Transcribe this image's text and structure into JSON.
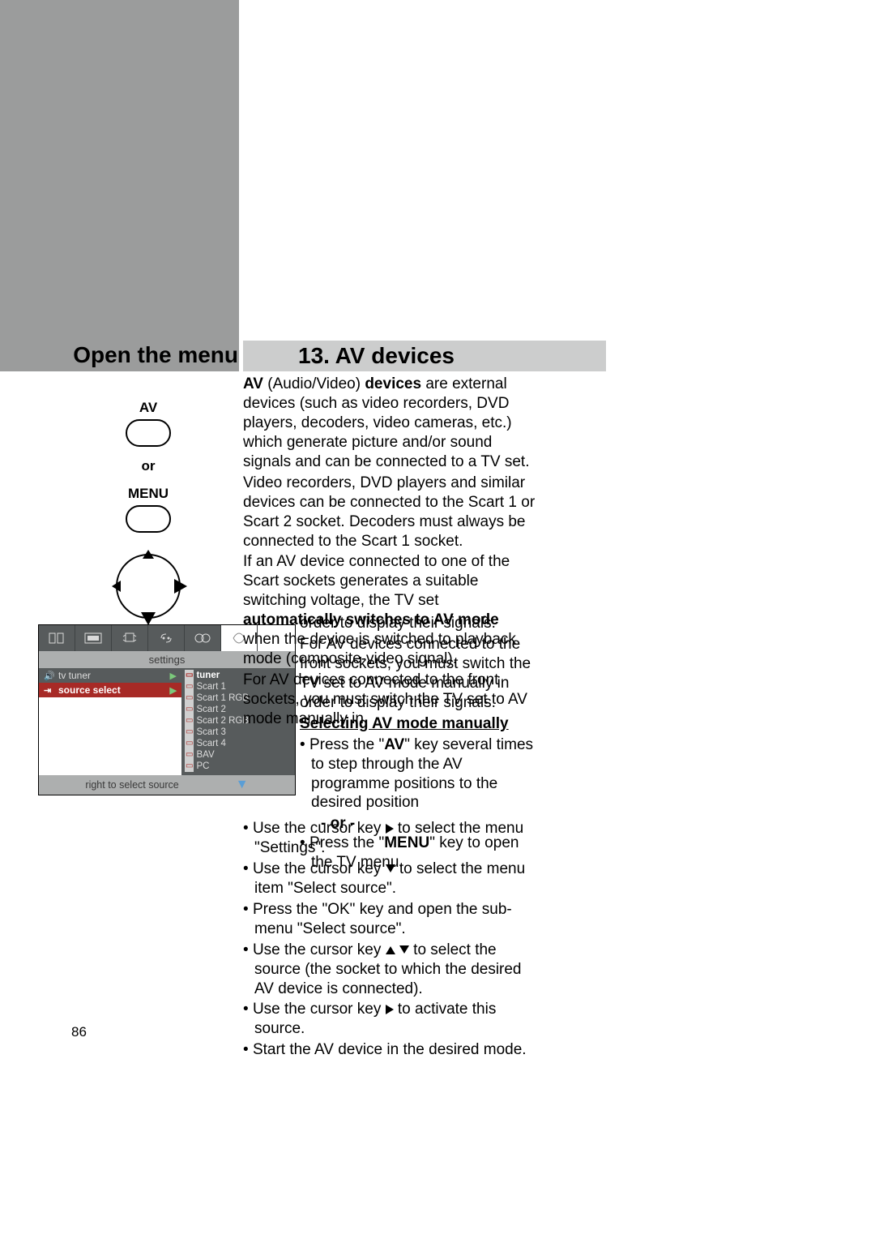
{
  "header": {
    "open_menu": "Open the menu",
    "section_title": "13. AV devices"
  },
  "left": {
    "av": "AV",
    "or": "or",
    "menu": "MENU"
  },
  "osd": {
    "settings": "settings",
    "tv_tuner": "tv tuner",
    "source_select": "source select",
    "sources": {
      "tuner": "tuner",
      "scart1": "Scart 1",
      "scart1rgb": "Scart 1 RGB",
      "scart2": "Scart 2",
      "scart2rgb": "Scart 2 RGB",
      "scart3": "Scart 3",
      "scart4": "Scart 4",
      "bav": "BAV",
      "pc": "PC"
    },
    "footer": "right to select source"
  },
  "body": {
    "p1a": "AV",
    "p1b": " (Audio/Video) ",
    "p1c": "devices",
    "p1d": " are external devices (such as video recorders, DVD players, decoders, video cameras, etc.) which generate picture and/or sound signals and can be connected to a TV set.",
    "p2": "Video recorders, DVD players and similar devices can be connected to the Scart 1 or Scart 2 socket. Decoders must always be connected to the Scart 1 socket.",
    "p3a": "If an AV device connected to one of the Scart sockets generates a suitable switching voltage, the TV set ",
    "p3b": "automatically switches to AV mode",
    "p3c": " when the device is switched to playback mode (composite-video signal).",
    "p4": "For AV devices connected to the front sockets, you must switch the TV set to AV mode manually in"
  },
  "narrow": {
    "p1": "order to display their signals.",
    "p2": "For AV devices connected to the front sockets, you must switch the TV set to AV mode manually in order to display their signals.",
    "subhead": "Selecting AV mode manually",
    "b1a": "Press the \"",
    "b1b": "AV",
    "b1c": "\" key several times to step through the AV programme positions to the desired position",
    "or": "- or -",
    "b2a": "Press the \"",
    "b2b": "MENU",
    "b2c": "\" key to open the TV menu."
  },
  "lower": {
    "b1": "Use the cursor key ▶ to select the menu \"Settings\".",
    "b2": "Use the cursor key ▼ to select the menu item \"Select source\".",
    "b3": "Press the \"OK\" key and open the sub-menu \"Select source\".",
    "b4": "Use the cursor key ▲ ▼ to select the source (the socket to which the desired AV device is connected).",
    "b5": "Use the cursor key ▶ to activate this source.",
    "b6": "Start the AV device in the desired mode."
  },
  "page_number": "86"
}
